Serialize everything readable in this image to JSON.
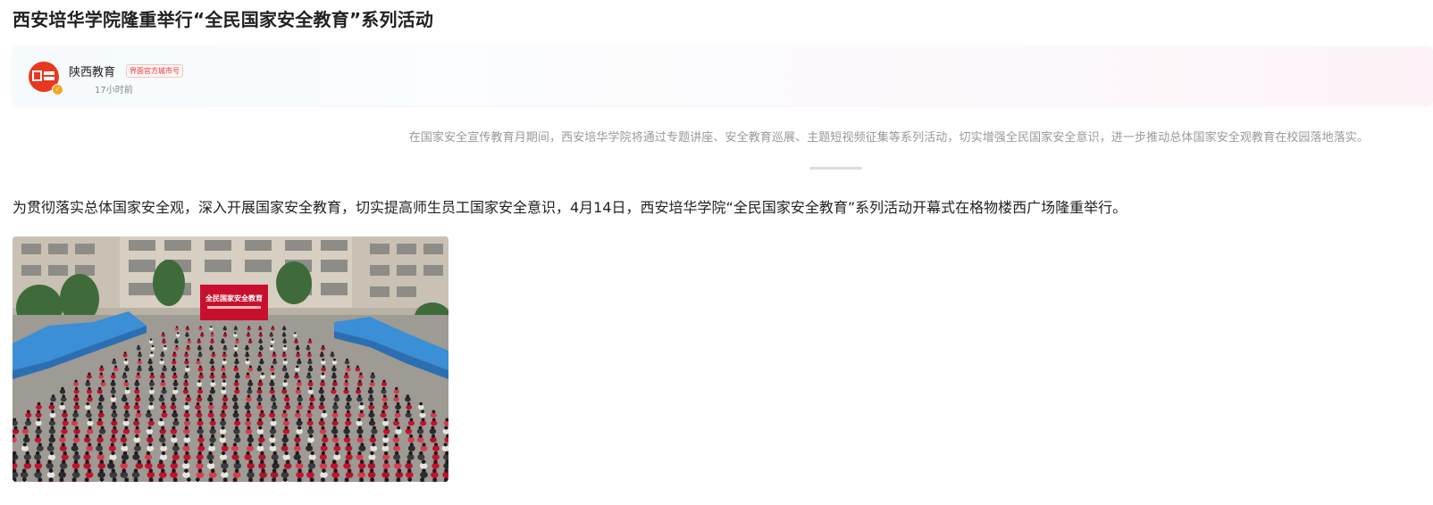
{
  "article": {
    "title": "西安培华学院隆重举行“全民国家安全教育”系列活动",
    "summary": "在国家安全宣传教育月期间，西安培华学院将通过专题讲座、安全教育巡展、主题短视频征集等系列活动，切实增强全民国家安全意识，进一步推动总体国家安全观教育在校园落地落实。",
    "paragraphs": [
      "为贯彻落实总体国家安全观，深入开展国家安全教育，切实提高师生员工国家安全意识，4月14日，西安培华学院“全民国家安全教育”系列活动开幕式在格物楼西广场隆重举行。"
    ],
    "photo": {
      "banner_text": "全民国家安全教育",
      "icon": "event-photo"
    }
  },
  "author": {
    "name": "陕西教育",
    "tag": "界面官方城市号",
    "time": "17小时前",
    "avatar_icon": "media-logo-avatar",
    "badge_icon": "verified-badge-icon"
  },
  "colors": {
    "avatar_bg": "#e8381f",
    "tag_text": "#e53935",
    "summary_text": "#999999",
    "banner_red": "#c8102e"
  }
}
